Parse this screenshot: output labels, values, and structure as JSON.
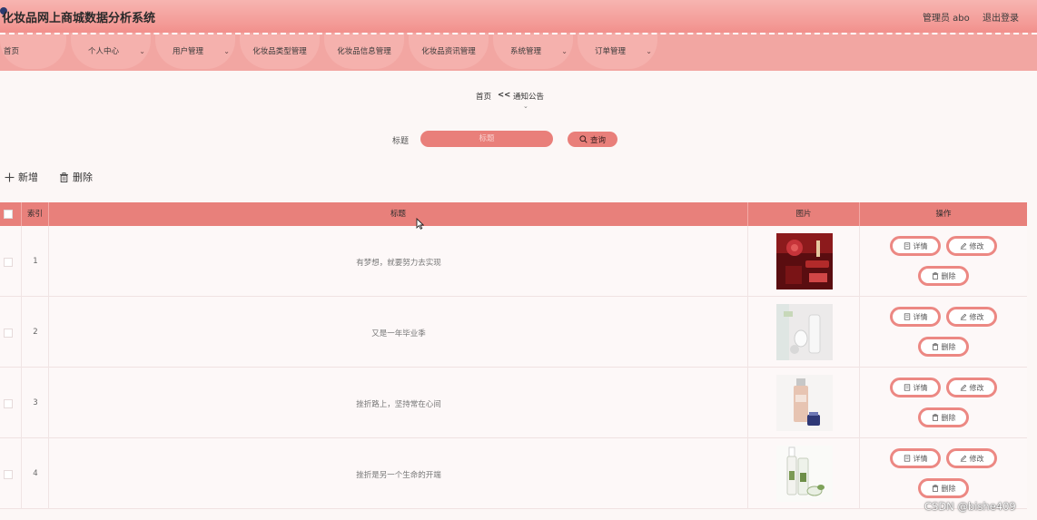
{
  "header": {
    "app_title": "化妆品网上商城数据分析系统",
    "admin_label": "管理员 abo",
    "logout_label": "退出登录"
  },
  "nav": [
    {
      "label": "首页",
      "dropdown": false
    },
    {
      "label": "个人中心",
      "dropdown": true
    },
    {
      "label": "用户管理",
      "dropdown": true
    },
    {
      "label": "化妆品类型管理",
      "dropdown": false
    },
    {
      "label": "化妆品信息管理",
      "dropdown": false
    },
    {
      "label": "化妆品资讯管理",
      "dropdown": false
    },
    {
      "label": "系统管理",
      "dropdown": true
    },
    {
      "label": "订单管理",
      "dropdown": true
    }
  ],
  "breadcrumb": {
    "home": "首页",
    "separator": "<<",
    "current": "通知公告"
  },
  "search": {
    "label": "标题",
    "placeholder": "标题",
    "button_label": "查询"
  },
  "toolbar": {
    "add_label": "新增",
    "delete_label": "删除"
  },
  "table": {
    "columns": [
      "索引",
      "标题",
      "图片",
      "操作"
    ],
    "rows": [
      {
        "index": "1",
        "title": "有梦想，就要努力去实现",
        "image": "red-cosmetics-product-photo"
      },
      {
        "index": "2",
        "title": "又是一年毕业季",
        "image": "white-skincare-product-photo"
      },
      {
        "index": "3",
        "title": "挫折路上，坚持常在心间",
        "image": "foundation-bottle-product-photo"
      },
      {
        "index": "4",
        "title": "挫折是另一个生命的开端",
        "image": "green-skincare-set-product-photo"
      }
    ],
    "actions": {
      "detail_label": "详情",
      "edit_label": "修改",
      "delete_label": "删除"
    }
  },
  "watermark": "CSDN @bishe409",
  "colors": {
    "header_top": "#f7b5b1",
    "header_bottom": "#f2908c",
    "nav_bg": "#f2a6a2",
    "accent": "#e97f7a",
    "table_header": "#e8807b",
    "button_border": "#ec8883"
  }
}
